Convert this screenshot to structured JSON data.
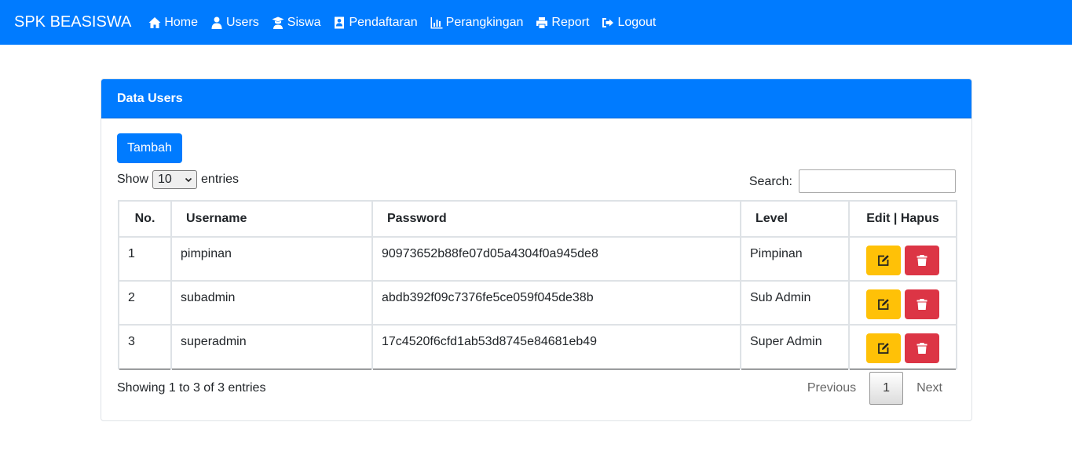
{
  "navbar": {
    "brand": "SPK BEASISWA",
    "items": [
      {
        "label": "Home",
        "icon": "home-icon"
      },
      {
        "label": "Users",
        "icon": "users-icon"
      },
      {
        "label": "Siswa",
        "icon": "student-icon"
      },
      {
        "label": "Pendaftaran",
        "icon": "address-card-icon"
      },
      {
        "label": "Perangkingan",
        "icon": "bar-chart-icon"
      },
      {
        "label": "Report",
        "icon": "print-icon"
      },
      {
        "label": "Logout",
        "icon": "logout-icon"
      }
    ],
    "color": "#007bff"
  },
  "card": {
    "title": "Data Users",
    "add_button": "Tambah"
  },
  "table_controls": {
    "show_label": "Show",
    "page_length": "10",
    "entries_label": "entries",
    "search_label": "Search:",
    "search_value": ""
  },
  "table": {
    "headers": [
      "No.",
      "Username",
      "Password",
      "Level",
      "Edit | Hapus"
    ],
    "rows": [
      {
        "no": "1",
        "username": "pimpinan",
        "password": "90973652b88fe07d05a4304f0a945de8",
        "level": "Pimpinan"
      },
      {
        "no": "2",
        "username": "subadmin",
        "password": "abdb392f09c7376fe5ce059f045de38b",
        "level": "Sub Admin"
      },
      {
        "no": "3",
        "username": "superadmin",
        "password": "17c4520f6cfd1ab53d8745e84681eb49",
        "level": "Super Admin"
      }
    ]
  },
  "footer": {
    "info": "Showing 1 to 3 of 3 entries",
    "previous": "Previous",
    "current_page": "1",
    "next": "Next"
  },
  "colors": {
    "primary": "#007bff",
    "edit": "#ffc107",
    "delete": "#dc3545"
  }
}
